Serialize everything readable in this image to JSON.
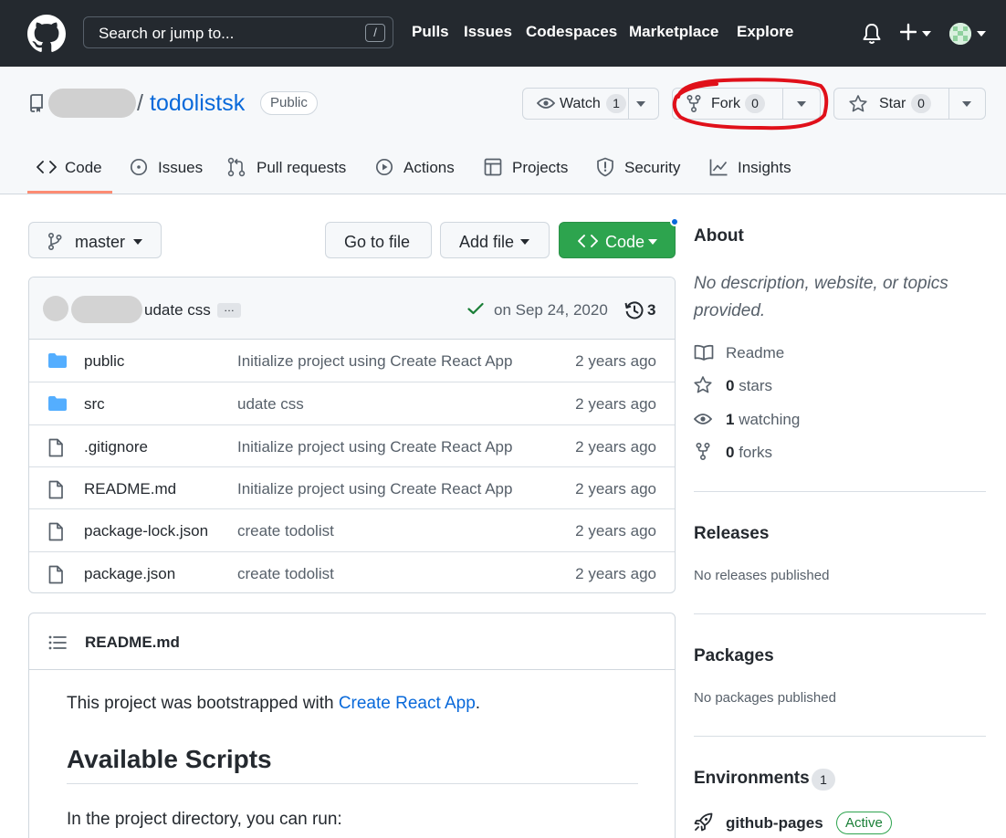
{
  "header": {
    "search_placeholder": "Search or jump to...",
    "slash_key": "/",
    "nav": [
      "Pulls",
      "Issues",
      "Codespaces",
      "Marketplace",
      "Explore"
    ]
  },
  "repo": {
    "slash": "/",
    "name": "todolistsk",
    "visibility": "Public",
    "watch": {
      "label": "Watch",
      "count": "1"
    },
    "fork": {
      "label": "Fork",
      "count": "0"
    },
    "star": {
      "label": "Star",
      "count": "0"
    }
  },
  "tabs": [
    "Code",
    "Issues",
    "Pull requests",
    "Actions",
    "Projects",
    "Security",
    "Insights"
  ],
  "toolbar": {
    "branch": "master",
    "go_to_file": "Go to file",
    "add_file": "Add file",
    "code": "Code"
  },
  "commit": {
    "message": "udate css",
    "ellipsis": "…",
    "date": "on Sep 24, 2020",
    "history_count": "3"
  },
  "files": [
    {
      "type": "folder",
      "name": "public",
      "commit": "Initialize project using Create React App",
      "age": "2 years ago"
    },
    {
      "type": "folder",
      "name": "src",
      "commit": "udate css",
      "age": "2 years ago"
    },
    {
      "type": "file",
      "name": ".gitignore",
      "commit": "Initialize project using Create React App",
      "age": "2 years ago"
    },
    {
      "type": "file",
      "name": "README.md",
      "commit": "Initialize project using Create React App",
      "age": "2 years ago"
    },
    {
      "type": "file",
      "name": "package-lock.json",
      "commit": "create todolist",
      "age": "2 years ago"
    },
    {
      "type": "file",
      "name": "package.json",
      "commit": "create todolist",
      "age": "2 years ago"
    }
  ],
  "readme": {
    "title": "README.md",
    "p1_prefix": "This project was bootstrapped with ",
    "p1_link": "Create React App",
    "p1_suffix": ".",
    "h2": "Available Scripts",
    "p2": "In the project directory, you can run:"
  },
  "sidebar": {
    "about_title": "About",
    "about_desc": "No description, website, or topics provided.",
    "readme": "Readme",
    "stars_count": "0",
    "stars_label": " stars",
    "watching_count": "1",
    "watching_label": " watching",
    "forks_count": "0",
    "forks_label": " forks",
    "releases_title": "Releases",
    "releases_text": "No releases published",
    "packages_title": "Packages",
    "packages_text": "No packages published",
    "environments_title": "Environments",
    "environments_count": "1",
    "env_name": "github-pages",
    "env_status": "Active"
  },
  "colors": {
    "header_bg": "#24292f",
    "link": "#0969da",
    "green_button": "#2da44e",
    "annotation_red": "#e0101a"
  }
}
